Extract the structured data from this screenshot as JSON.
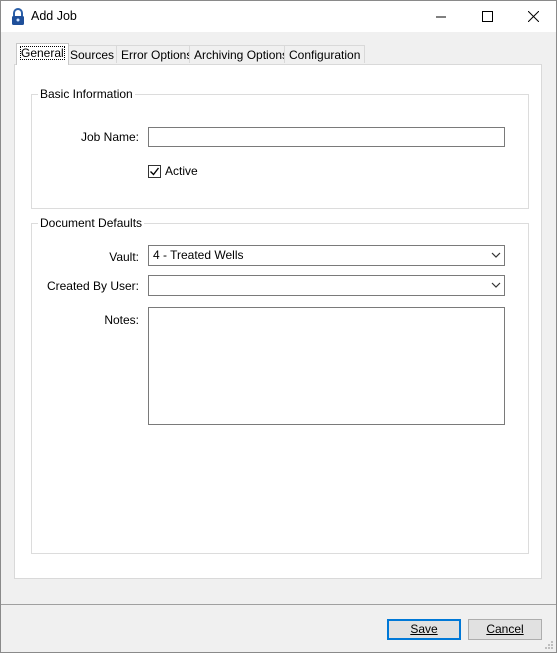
{
  "window": {
    "title": "Add Job"
  },
  "tabs": [
    {
      "label": "General",
      "active": true
    },
    {
      "label": "Sources"
    },
    {
      "label": "Error Options"
    },
    {
      "label": "Archiving Options"
    },
    {
      "label": "Configuration"
    }
  ],
  "basic_info": {
    "legend": "Basic Information",
    "job_name_label": "Job Name:",
    "job_name_value": "",
    "active_label": "Active",
    "active_checked": true
  },
  "document_defaults": {
    "legend": "Document Defaults",
    "vault_label": "Vault:",
    "vault_value": "4 - Treated Wells",
    "created_by_label": "Created By User:",
    "created_by_value": "",
    "notes_label": "Notes:",
    "notes_value": ""
  },
  "buttons": {
    "save_label": "Save",
    "cancel_label": "Cancel"
  },
  "icons": {
    "app": "lock-icon",
    "minimize": "minimize-icon",
    "maximize": "maximize-icon",
    "close": "close-icon",
    "dropdown": "chevron-down-icon"
  },
  "colors": {
    "accent": "#0078d7",
    "window_bg": "#f0f0f0"
  }
}
